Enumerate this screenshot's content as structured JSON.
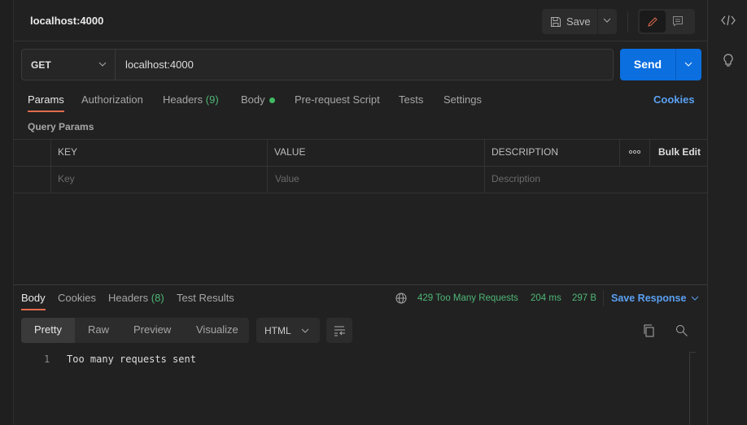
{
  "header": {
    "title": "localhost:4000",
    "save_label": "Save"
  },
  "request": {
    "method": "GET",
    "url": "localhost:4000",
    "send_label": "Send"
  },
  "request_tabs": [
    {
      "label": "Params"
    },
    {
      "label": "Authorization"
    },
    {
      "label": "Headers",
      "count": "(9)"
    },
    {
      "label": "Body"
    },
    {
      "label": "Pre-request Script"
    },
    {
      "label": "Tests"
    },
    {
      "label": "Settings"
    }
  ],
  "cookies_label": "Cookies",
  "query_params": {
    "title": "Query Params",
    "columns": [
      "KEY",
      "VALUE",
      "DESCRIPTION"
    ],
    "bulk_edit": "Bulk Edit",
    "placeholders": {
      "key": "Key",
      "value": "Value",
      "description": "Description"
    }
  },
  "response_tabs": [
    {
      "label": "Body"
    },
    {
      "label": "Cookies"
    },
    {
      "label": "Headers",
      "count": "(8)"
    },
    {
      "label": "Test Results"
    }
  ],
  "response_status": {
    "status": "429 Too Many Requests",
    "time": "204 ms",
    "size": "297 B",
    "save_response": "Save Response"
  },
  "response_modes": [
    "Pretty",
    "Raw",
    "Preview",
    "Visualize"
  ],
  "format": "HTML",
  "body_lines": [
    {
      "number": "1",
      "text": "Too many requests sent"
    }
  ],
  "colors": {
    "accent": "#e06c4c",
    "send": "#0b6fe0",
    "link": "#5aa0f2",
    "success": "#4fb777"
  }
}
